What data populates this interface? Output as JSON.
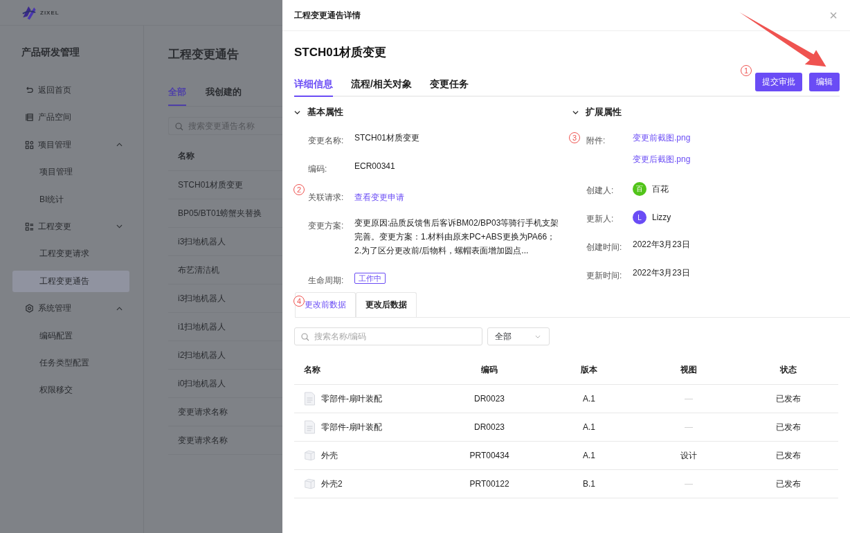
{
  "logo_text": "ZIXEL",
  "sidebar": {
    "title": "产品研发管理",
    "items": [
      {
        "label": "返回首页",
        "kind": "back",
        "selected": false
      },
      {
        "label": "产品空间",
        "kind": "space",
        "selected": false
      },
      {
        "label": "项目管理",
        "kind": "grid",
        "selected": false,
        "expanded": true,
        "children": [
          {
            "label": "项目管理",
            "selected": false
          },
          {
            "label": "BI统计",
            "selected": false
          }
        ]
      },
      {
        "label": "工程变更",
        "kind": "list",
        "selected": false,
        "expanded": false,
        "children": [
          {
            "label": "工程变更请求",
            "selected": false
          },
          {
            "label": "工程变更通告",
            "selected": true
          }
        ]
      },
      {
        "label": "系统管理",
        "kind": "gear",
        "selected": false,
        "expanded": true,
        "children": [
          {
            "label": "编码配置",
            "selected": false
          },
          {
            "label": "任务类型配置",
            "selected": false
          },
          {
            "label": "权限移交",
            "selected": false
          }
        ]
      }
    ]
  },
  "main": {
    "title": "工程变更通告",
    "tabs": [
      {
        "label": "全部",
        "selected": true
      },
      {
        "label": "我创建的",
        "selected": false
      }
    ],
    "search": {
      "placeholder": "搜索变更通告名称"
    },
    "column": "名称",
    "rows": [
      "STCH01材质变更",
      "BP05/BT01螃蟹夹替换",
      "i3扫地机器人",
      "布艺清洁机",
      "i3扫地机器人",
      "i1扫地机器人",
      "i2扫地机器人",
      "i0扫地机器人",
      "变更请求名称",
      "变更请求名称"
    ]
  },
  "drawer": {
    "title": "工程变更通告详情",
    "close": "×",
    "heading": "STCH01材质变更",
    "tabs": [
      {
        "label": "详细信息",
        "selected": true
      },
      {
        "label": "流程/相关对象",
        "selected": false
      },
      {
        "label": "变更任务",
        "selected": false
      }
    ],
    "buttons": [
      "提交审批",
      "编辑"
    ],
    "basic": {
      "title": "基本属性",
      "expanded": true,
      "fields": [
        {
          "label": "变更名称:",
          "kind": "text",
          "value": "STCH01材质变更"
        },
        {
          "label": "编码:",
          "kind": "text",
          "value": "ECR00341"
        },
        {
          "label": "关联请求:",
          "kind": "link",
          "value": "查看变更申请"
        },
        {
          "label": "变更方案:",
          "kind": "text",
          "value": "变更原因:品质反馈售后客诉BM02/BP03等骑行手机支架完善。变更方案：1.材料由原来PC+ABS更换为PA66；2.为了区分更改前/后物料，螺帽表面增加圆点..."
        },
        {
          "label": "生命周期:",
          "kind": "tag",
          "value": "工作中"
        }
      ]
    },
    "extended": {
      "title": "扩展属性",
      "expanded": true,
      "fields": [
        {
          "label": "附件:",
          "kind": "links",
          "values": [
            "变更前截图.png",
            "变更后截图.png"
          ]
        },
        {
          "label": "创建人:",
          "kind": "user",
          "value": "百花",
          "avatar": "百",
          "color": "#52c41a"
        },
        {
          "label": "更新人:",
          "kind": "user",
          "value": "Lizzy",
          "avatar": "L",
          "color": "#6a4cf5"
        },
        {
          "label": "创建时间:",
          "kind": "text",
          "value": "2022年3月23日"
        },
        {
          "label": "更新时间:",
          "kind": "text",
          "value": "2022年3月23日"
        }
      ]
    },
    "subtabs": [
      {
        "label": "更改前数据",
        "selected": true
      },
      {
        "label": "更改后数据",
        "selected": false
      }
    ],
    "search": {
      "placeholder": "搜索名称/编码"
    },
    "filter": "全部",
    "columns": [
      "名称",
      "编码",
      "版本",
      "视图",
      "状态"
    ],
    "rows": [
      {
        "kind": "document",
        "name": "零部件-扇叶装配",
        "code": "DR0023",
        "version": "A.1",
        "view": "—",
        "status": "已发布"
      },
      {
        "kind": "document",
        "name": "零部件-扇叶装配",
        "code": "DR0023",
        "version": "A.1",
        "view": "—",
        "status": "已发布"
      },
      {
        "kind": "part",
        "name": "外壳",
        "code": "PRT00434",
        "version": "A.1",
        "view": "设计",
        "status": "已发布"
      },
      {
        "kind": "part",
        "name": "外壳2",
        "code": "PRT00122",
        "version": "B.1",
        "view": "—",
        "status": "已发布"
      }
    ]
  },
  "annotations": [
    "1",
    "2",
    "3",
    "4"
  ]
}
